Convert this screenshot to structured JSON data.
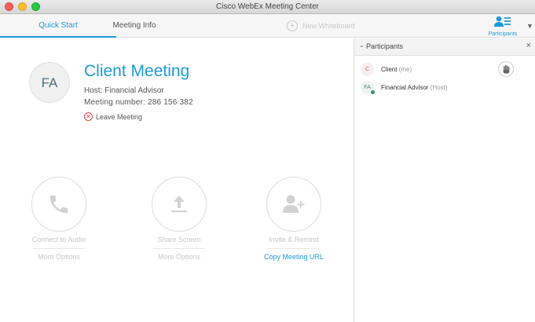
{
  "window": {
    "title": "Cisco WebEx Meeting Center"
  },
  "toolbar": {
    "tabs": [
      {
        "label": "Quick Start"
      },
      {
        "label": "Meeting Info"
      }
    ],
    "whiteboard_label": "New Whiteboard",
    "participants_label": "Participants"
  },
  "meeting": {
    "avatar_initials": "FA",
    "title": "Client Meeting",
    "host_text": "Host: Financial Advisor",
    "number_text": "Meeting number: 286 156 382",
    "leave_label": "Leave Meeting"
  },
  "actions": [
    {
      "label": "Connect to Audio",
      "secondary": "More Options"
    },
    {
      "label": "Share Screen",
      "secondary": "More Options"
    },
    {
      "label": "Invite & Remind",
      "secondary": "Copy Meeting URL"
    }
  ],
  "panel": {
    "title": "Participants",
    "participants": [
      {
        "initials": "C",
        "name": "Client",
        "role": "(me)"
      },
      {
        "initials": "FA",
        "name": "Financial Advisor",
        "role": "(Host)"
      }
    ]
  },
  "colors": {
    "accent": "#1d9bd8",
    "leave": "#e04545",
    "host_status": "#1e9b63"
  }
}
